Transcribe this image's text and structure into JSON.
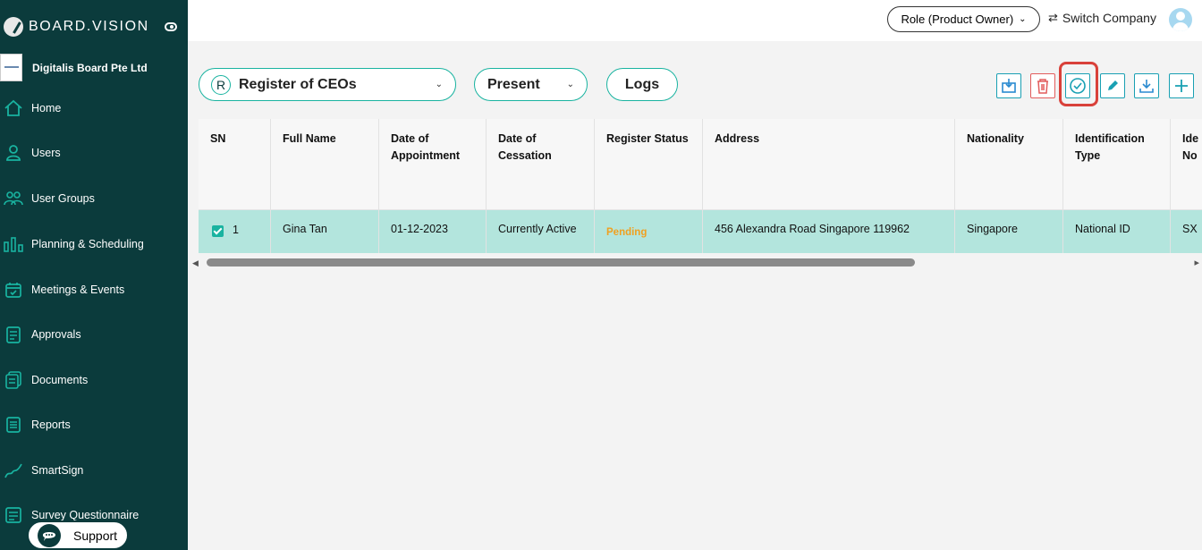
{
  "brand": {
    "name": "BOARD.VISION"
  },
  "org": {
    "name": "Digitalis Board Pte Ltd"
  },
  "nav": [
    {
      "label": "Home",
      "icon": "home-icon"
    },
    {
      "label": "Users",
      "icon": "user-icon"
    },
    {
      "label": "User Groups",
      "icon": "user-groups-icon"
    },
    {
      "label": "Planning & Scheduling",
      "icon": "bar-chart-icon"
    },
    {
      "label": "Meetings & Events",
      "icon": "calendar-icon"
    },
    {
      "label": "Approvals",
      "icon": "clipboard-icon"
    },
    {
      "label": "Documents",
      "icon": "documents-icon"
    },
    {
      "label": "Reports",
      "icon": "report-icon"
    },
    {
      "label": "SmartSign",
      "icon": "signature-icon"
    },
    {
      "label": "Survey Questionnaire",
      "icon": "survey-icon"
    }
  ],
  "support": {
    "label": "Support"
  },
  "topbar": {
    "role": "Role (Product Owner)",
    "switch_company": "Switch Company"
  },
  "filters": {
    "register": {
      "badge": "R",
      "label": "Register of CEOs"
    },
    "period": "Present",
    "logs": "Logs"
  },
  "toolbar": [
    "import",
    "delete",
    "approve",
    "edit",
    "download",
    "add"
  ],
  "table": {
    "columns": [
      "SN",
      "Full Name",
      "Date of Appointment",
      "Date of Cessation",
      "Register Status",
      "Address",
      "Nationality",
      "Identification Type",
      "Identification No"
    ],
    "column_display": [
      "SN",
      "Full Name",
      "Date of\nAppointment",
      "Date of\nCessation",
      "Register Status",
      "Address",
      "Nationality",
      "Identification\nType",
      "Ide\nNo"
    ],
    "rows": [
      {
        "selected": true,
        "sn": "1",
        "full_name": "Gina Tan",
        "date_of_appointment": "01-12-2023",
        "date_of_cessation": "Currently Active",
        "register_status": "Pending",
        "address": "456 Alexandra Road Singapore 119962",
        "nationality": "Singapore",
        "identification_type": "National ID",
        "identification_no": "SX"
      }
    ]
  },
  "colors": {
    "sidebar": "#0b3b3c",
    "accent": "#19b3a0",
    "selected_row": "#b3e5dd",
    "pending": "#f0a020",
    "highlight": "#d9413a"
  }
}
